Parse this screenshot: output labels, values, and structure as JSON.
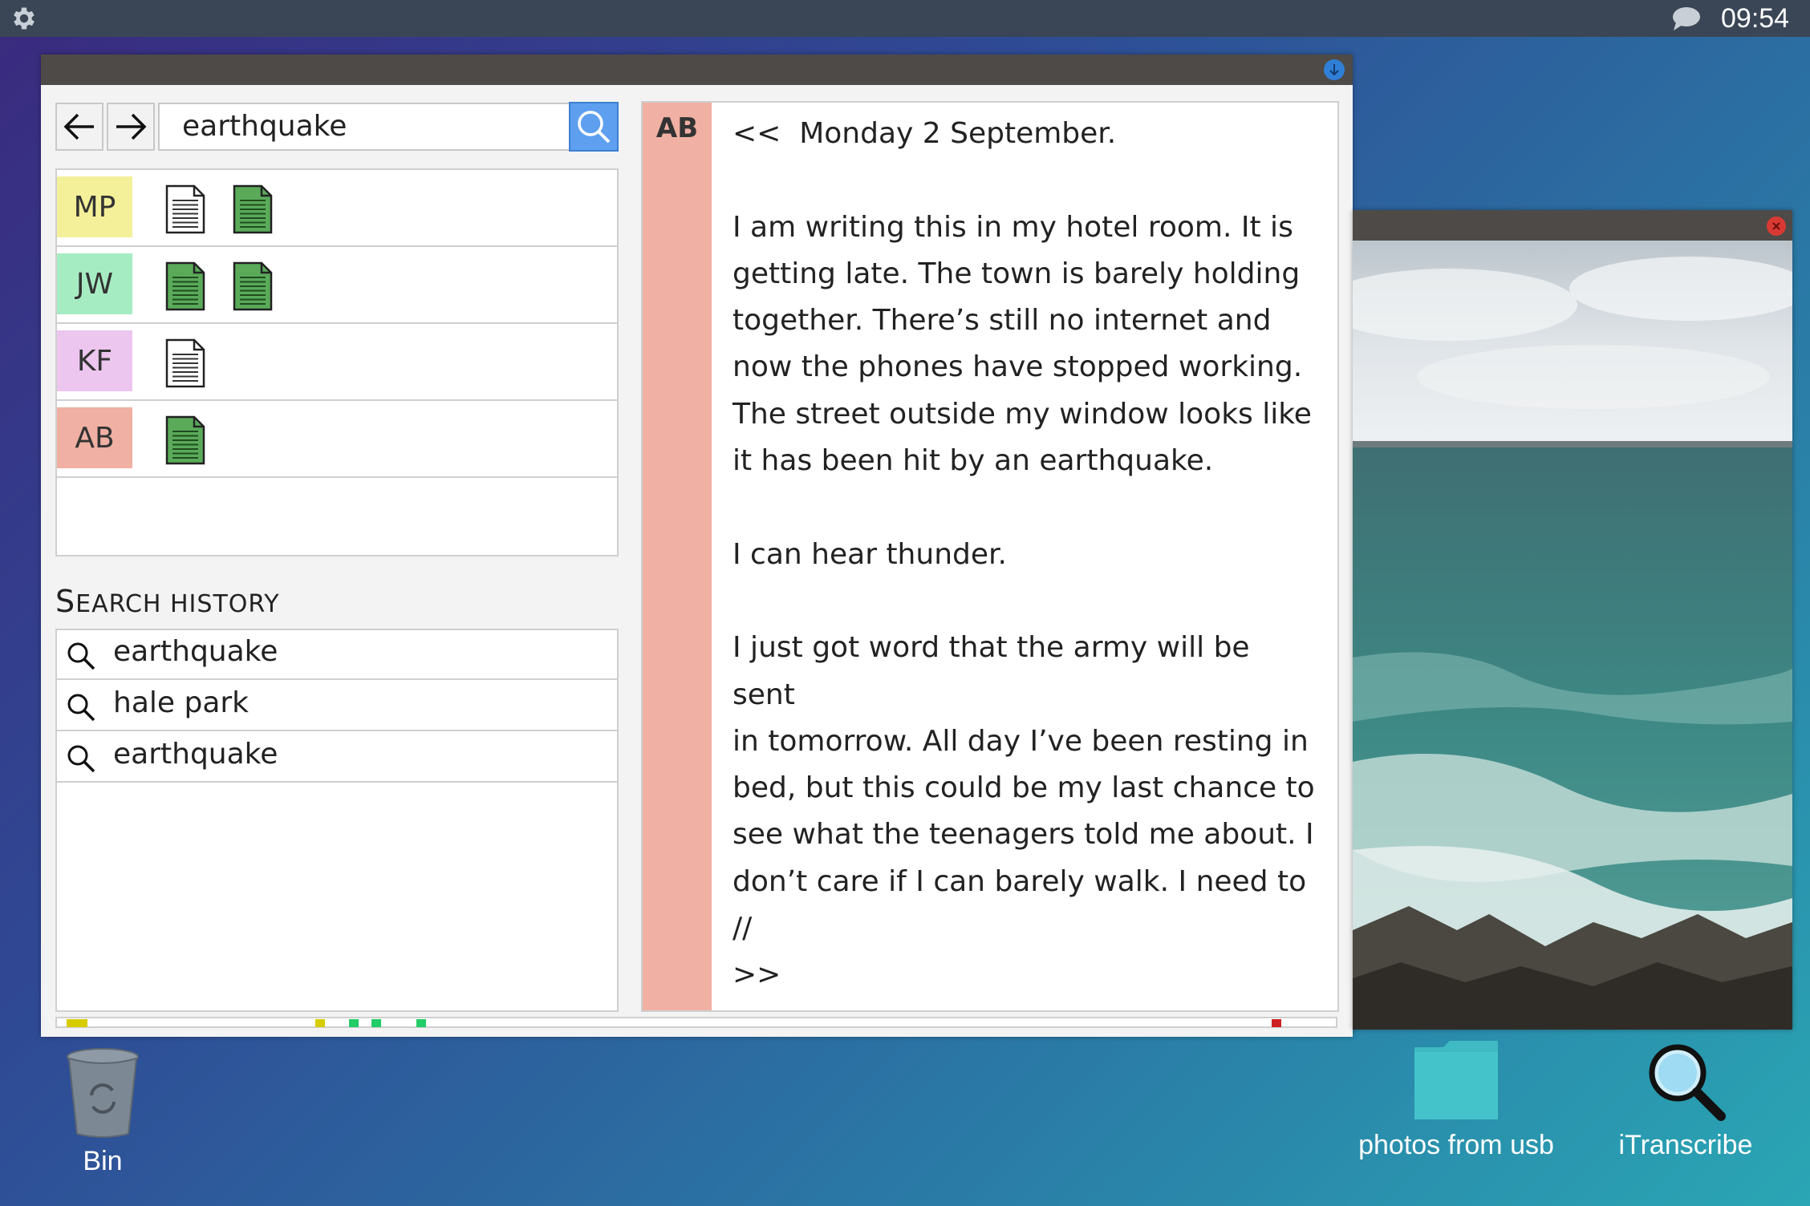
{
  "topbar": {
    "clock": "09:54"
  },
  "search": {
    "query": "earthquake"
  },
  "results": [
    {
      "tag": "MP",
      "color": "#f4f09a",
      "docs": [
        "white",
        "green"
      ]
    },
    {
      "tag": "JW",
      "color": "#a6ecc3",
      "docs": [
        "green",
        "green"
      ]
    },
    {
      "tag": "KF",
      "color": "#ecc6ef",
      "docs": [
        "white"
      ]
    },
    {
      "tag": "AB",
      "color": "#f0b0a3",
      "docs": [
        "green"
      ]
    }
  ],
  "history": {
    "title_first": "S",
    "title_rest": "EARCH HISTORY",
    "items": [
      "earthquake",
      "hale park",
      "earthquake"
    ]
  },
  "timeline_colors": {
    "yellow": "#d6cc00",
    "green": "#22cc66",
    "red": "#cc2222"
  },
  "document": {
    "author_tag": "AB",
    "text": "<<  Monday 2 September.\n\nI am writing this in my hotel room. It is\ngetting late. The town is barely holding\ntogether. There’s still no internet and\nnow the phones have stopped working.\nThe street outside my window looks like\nit has been hit by an earthquake.\n\nI can hear thunder.\n\nI just got word that the army will be sent\nin tomorrow. All day I’ve been resting in\nbed, but this could be my last chance to\nsee what the teenagers told me about. I\ndon’t care if I can barely walk. I need to //\n>>"
  },
  "desktop": {
    "bin": "Bin",
    "folder": "photos from usb",
    "app": "iTranscribe"
  }
}
